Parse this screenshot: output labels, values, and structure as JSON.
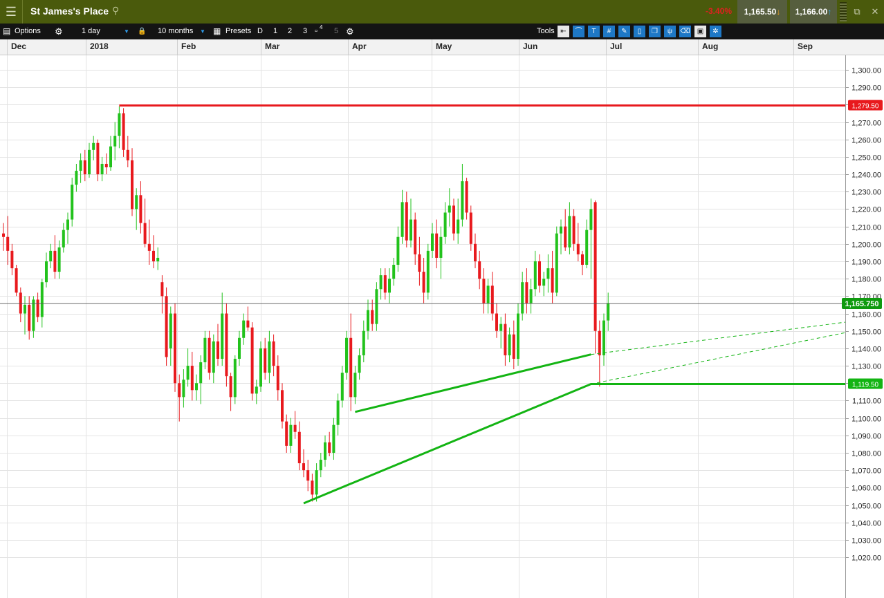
{
  "header": {
    "menu_icon": "hamburger-icon",
    "title": "St James's Place",
    "search_icon": "search-icon",
    "change": "-3.40%",
    "sell_price": "1,165.50",
    "sell_arrow": "↓",
    "buy_price": "1,166.00",
    "buy_arrow": "↑",
    "popout_icon": "popout-icon",
    "close_label": "✕"
  },
  "toolbar": {
    "options_label": "Options",
    "interval": "1 day",
    "period": "10 months",
    "presets_label": "Presets",
    "preset_buttons": [
      "D",
      "1",
      "2",
      "3"
    ],
    "preset_save_badge": "4",
    "preset_5": "5",
    "tools_label": "Tools",
    "tool_icons": [
      "back-icon",
      "curve-icon",
      "text-icon",
      "grid-icon",
      "drawing-icon",
      "candle-icon",
      "layers-icon",
      "indicator-icon",
      "eraser-icon",
      "print-icon",
      "settings-icon"
    ]
  },
  "colors": {
    "up": "#22c21c",
    "down": "#e8191d",
    "red_line": "#e8191d",
    "green_line": "#13b413",
    "grid": "#e3e3e3"
  },
  "chart_data": {
    "type": "candlestick",
    "instrument": "St James's Place",
    "interval": "1 day",
    "x_axis": {
      "months": [
        "Dec",
        "2018",
        "Feb",
        "Mar",
        "Apr",
        "May",
        "Jun",
        "Jul",
        "Aug",
        "Sep"
      ]
    },
    "y_axis": {
      "min": 1015,
      "max": 1305,
      "side": "right",
      "ticks": [
        1020,
        1030,
        1040,
        1050,
        1060,
        1070,
        1080,
        1090,
        1100,
        1110,
        1120,
        1130,
        1140,
        1150,
        1160,
        1170,
        1180,
        1190,
        1200,
        1210,
        1220,
        1230,
        1240,
        1250,
        1260,
        1270,
        1280,
        1290,
        1300
      ],
      "tick_labels": [
        "1,020.00",
        "1,030.00",
        "1,040.00",
        "1,050.00",
        "1,060.00",
        "1,070.00",
        "1,080.00",
        "1,090.00",
        "1,100.00",
        "1,110.00",
        "1,120.00",
        "1,130.00",
        "1,140.00",
        "1,150.00",
        "1,160.00",
        "1,170.00",
        "1,180.00",
        "1,190.00",
        "1,200.00",
        "1,210.00",
        "1,220.00",
        "1,230.00",
        "1,240.00",
        "1,250.00",
        "1,260.00",
        "1,270.00",
        "1,280.00",
        "1,290.00",
        "1,300.00"
      ]
    },
    "grid": true,
    "candles": [
      [
        1206,
        1212,
        1196,
        1204
      ],
      [
        1204,
        1216,
        1188,
        1196
      ],
      [
        1196,
        1200,
        1182,
        1186
      ],
      [
        1186,
        1188,
        1170,
        1172
      ],
      [
        1172,
        1175,
        1155,
        1160
      ],
      [
        1160,
        1170,
        1148,
        1165
      ],
      [
        1165,
        1170,
        1145,
        1150
      ],
      [
        1150,
        1170,
        1146,
        1168
      ],
      [
        1168,
        1172,
        1155,
        1158
      ],
      [
        1158,
        1180,
        1152,
        1178
      ],
      [
        1178,
        1195,
        1175,
        1190
      ],
      [
        1190,
        1200,
        1186,
        1196
      ],
      [
        1196,
        1205,
        1180,
        1184
      ],
      [
        1184,
        1202,
        1180,
        1198
      ],
      [
        1198,
        1212,
        1195,
        1208
      ],
      [
        1208,
        1218,
        1200,
        1214
      ],
      [
        1214,
        1238,
        1210,
        1234
      ],
      [
        1234,
        1246,
        1230,
        1242
      ],
      [
        1242,
        1252,
        1235,
        1248
      ],
      [
        1248,
        1254,
        1236,
        1240
      ],
      [
        1240,
        1258,
        1238,
        1254
      ],
      [
        1254,
        1262,
        1248,
        1258
      ],
      [
        1258,
        1260,
        1236,
        1240
      ],
      [
        1240,
        1250,
        1236,
        1246
      ],
      [
        1246,
        1252,
        1240,
        1244
      ],
      [
        1244,
        1262,
        1242,
        1256
      ],
      [
        1256,
        1270,
        1248,
        1262
      ],
      [
        1262,
        1279,
        1255,
        1275
      ],
      [
        1275,
        1278,
        1250,
        1254
      ],
      [
        1254,
        1262,
        1244,
        1248
      ],
      [
        1248,
        1255,
        1216,
        1220
      ],
      [
        1220,
        1232,
        1208,
        1228
      ],
      [
        1228,
        1236,
        1206,
        1212
      ],
      [
        1212,
        1226,
        1198,
        1200
      ],
      [
        1200,
        1214,
        1188,
        1196
      ],
      [
        1196,
        1205,
        1186,
        1190
      ],
      [
        1190,
        1198,
        1185,
        1192
      ],
      [
        1178,
        1182,
        1160,
        1170
      ],
      [
        1170,
        1175,
        1130,
        1135
      ],
      [
        1140,
        1164,
        1130,
        1160
      ],
      [
        1160,
        1166,
        1115,
        1120
      ],
      [
        1120,
        1125,
        1098,
        1112
      ],
      [
        1112,
        1128,
        1106,
        1122
      ],
      [
        1122,
        1140,
        1118,
        1130
      ],
      [
        1130,
        1138,
        1110,
        1116
      ],
      [
        1116,
        1125,
        1110,
        1120
      ],
      [
        1120,
        1136,
        1108,
        1132
      ],
      [
        1132,
        1150,
        1128,
        1146
      ],
      [
        1146,
        1150,
        1122,
        1126
      ],
      [
        1126,
        1148,
        1120,
        1144
      ],
      [
        1144,
        1154,
        1130,
        1134
      ],
      [
        1134,
        1172,
        1130,
        1160
      ],
      [
        1160,
        1166,
        1118,
        1124
      ],
      [
        1124,
        1126,
        1104,
        1112
      ],
      [
        1112,
        1136,
        1108,
        1134
      ],
      [
        1134,
        1150,
        1130,
        1146
      ],
      [
        1146,
        1160,
        1142,
        1156
      ],
      [
        1156,
        1164,
        1150,
        1152
      ],
      [
        1152,
        1155,
        1110,
        1114
      ],
      [
        1114,
        1122,
        1108,
        1118
      ],
      [
        1118,
        1144,
        1115,
        1140
      ],
      [
        1140,
        1146,
        1122,
        1126
      ],
      [
        1126,
        1150,
        1120,
        1144
      ],
      [
        1144,
        1148,
        1124,
        1130
      ],
      [
        1130,
        1136,
        1110,
        1116
      ],
      [
        1116,
        1120,
        1094,
        1098
      ],
      [
        1098,
        1102,
        1080,
        1084
      ],
      [
        1084,
        1100,
        1080,
        1096
      ],
      [
        1096,
        1104,
        1088,
        1092
      ],
      [
        1092,
        1098,
        1070,
        1074
      ],
      [
        1074,
        1082,
        1066,
        1070
      ],
      [
        1070,
        1076,
        1058,
        1064
      ],
      [
        1064,
        1068,
        1052,
        1056
      ],
      [
        1056,
        1074,
        1052,
        1070
      ],
      [
        1070,
        1080,
        1066,
        1076
      ],
      [
        1076,
        1090,
        1072,
        1086
      ],
      [
        1086,
        1092,
        1078,
        1080
      ],
      [
        1080,
        1100,
        1076,
        1096
      ],
      [
        1096,
        1114,
        1090,
        1110
      ],
      [
        1110,
        1130,
        1106,
        1126
      ],
      [
        1126,
        1150,
        1122,
        1146
      ],
      [
        1146,
        1160,
        1104,
        1112
      ],
      [
        1112,
        1130,
        1108,
        1126
      ],
      [
        1126,
        1140,
        1122,
        1136
      ],
      [
        1136,
        1156,
        1132,
        1150
      ],
      [
        1150,
        1168,
        1145,
        1162
      ],
      [
        1162,
        1168,
        1150,
        1154
      ],
      [
        1154,
        1178,
        1150,
        1174
      ],
      [
        1174,
        1186,
        1168,
        1182
      ],
      [
        1182,
        1186,
        1168,
        1172
      ],
      [
        1172,
        1186,
        1166,
        1180
      ],
      [
        1180,
        1192,
        1176,
        1188
      ],
      [
        1188,
        1210,
        1184,
        1204
      ],
      [
        1204,
        1231,
        1200,
        1224
      ],
      [
        1224,
        1230,
        1198,
        1202
      ],
      [
        1202,
        1226,
        1198,
        1214
      ],
      [
        1214,
        1218,
        1188,
        1194
      ],
      [
        1194,
        1204,
        1176,
        1184
      ],
      [
        1184,
        1192,
        1166,
        1172
      ],
      [
        1172,
        1200,
        1168,
        1196
      ],
      [
        1196,
        1212,
        1192,
        1206
      ],
      [
        1206,
        1214,
        1186,
        1192
      ],
      [
        1192,
        1210,
        1180,
        1204
      ],
      [
        1204,
        1224,
        1200,
        1218
      ],
      [
        1218,
        1232,
        1210,
        1222
      ],
      [
        1222,
        1226,
        1202,
        1206
      ],
      [
        1206,
        1226,
        1200,
        1214
      ],
      [
        1214,
        1246,
        1210,
        1236
      ],
      [
        1236,
        1238,
        1214,
        1218
      ],
      [
        1218,
        1222,
        1196,
        1200
      ],
      [
        1200,
        1206,
        1186,
        1190
      ],
      [
        1190,
        1196,
        1174,
        1180
      ],
      [
        1180,
        1186,
        1160,
        1166
      ],
      [
        1166,
        1180,
        1160,
        1176
      ],
      [
        1176,
        1184,
        1156,
        1160
      ],
      [
        1160,
        1166,
        1146,
        1150
      ],
      [
        1150,
        1158,
        1140,
        1154
      ],
      [
        1154,
        1160,
        1130,
        1136
      ],
      [
        1136,
        1152,
        1132,
        1148
      ],
      [
        1148,
        1156,
        1128,
        1134
      ],
      [
        1134,
        1166,
        1130,
        1160
      ],
      [
        1160,
        1184,
        1156,
        1178
      ],
      [
        1178,
        1186,
        1160,
        1166
      ],
      [
        1166,
        1180,
        1160,
        1174
      ],
      [
        1174,
        1196,
        1170,
        1190
      ],
      [
        1190,
        1194,
        1172,
        1176
      ],
      [
        1176,
        1184,
        1170,
        1180
      ],
      [
        1180,
        1194,
        1172,
        1186
      ],
      [
        1186,
        1196,
        1166,
        1172
      ],
      [
        1172,
        1210,
        1170,
        1206
      ],
      [
        1206,
        1214,
        1194,
        1210
      ],
      [
        1210,
        1220,
        1196,
        1198
      ],
      [
        1198,
        1224,
        1194,
        1216
      ],
      [
        1216,
        1220,
        1196,
        1200
      ],
      [
        1200,
        1212,
        1190,
        1194
      ],
      [
        1194,
        1196,
        1182,
        1188
      ],
      [
        1188,
        1214,
        1186,
        1208
      ],
      [
        1208,
        1226,
        1180,
        1220
      ],
      [
        1224,
        1225,
        1137,
        1150
      ],
      [
        1150,
        1156,
        1118,
        1136
      ],
      [
        1136,
        1160,
        1130,
        1156
      ],
      [
        1156,
        1172,
        1150,
        1166
      ]
    ],
    "lines": [
      {
        "name": "resistance",
        "color": "red",
        "points": [
          [
            27,
            1279.5
          ],
          [
            165,
            1279.5
          ]
        ],
        "price_label": "1,279.50"
      },
      {
        "name": "support-lower",
        "color": "green",
        "points": [
          [
            70,
            1051
          ],
          [
            137,
            1119.5
          ],
          [
            165,
            1119.5
          ]
        ],
        "price_label": "1,119.50"
      },
      {
        "name": "support-upper",
        "color": "green",
        "points": [
          [
            82,
            1103.5
          ],
          [
            137,
            1136.5
          ]
        ]
      },
      {
        "name": "upper-extension",
        "color": "green",
        "dashed": true,
        "points": [
          [
            137,
            1136.5
          ],
          [
            165,
            1155
          ]
        ]
      },
      {
        "name": "lower-extension",
        "color": "green",
        "dashed": true,
        "points": [
          [
            137,
            1119.5
          ],
          [
            165,
            1149
          ]
        ]
      }
    ],
    "last_price": 1165.75,
    "last_price_label": "1,165.750"
  }
}
